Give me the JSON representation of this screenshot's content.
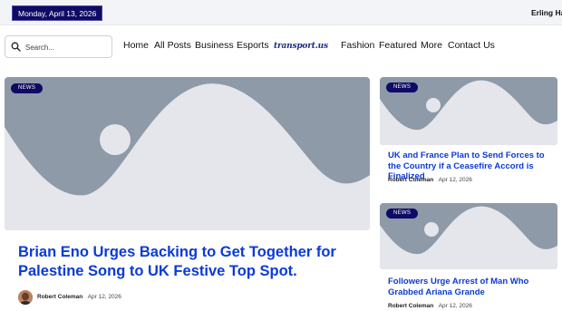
{
  "topbar": {
    "date": "Monday, April 13, 2026",
    "ticker": "Erling Haa"
  },
  "search": {
    "placeholder": "Search..."
  },
  "nav": {
    "items": [
      "Home",
      "All Posts",
      "Business",
      "Esports",
      "Fashion",
      "Featured",
      "More",
      "Contact Us"
    ],
    "logo_text": "transport.us"
  },
  "main_article": {
    "badge": "NEWS",
    "title": "Brian Eno Urges Backing to Get Together for Palestine Song to UK Festive Top Spot.",
    "author": "Robert Coleman",
    "date": "Apr 12, 2026"
  },
  "side_articles": [
    {
      "badge": "NEWS",
      "title": "UK and France Plan to Send Forces to the Country if a Ceasefire Accord is Finalized",
      "author": "Robert Coleman",
      "date": "Apr 12, 2026"
    },
    {
      "badge": "NEWS",
      "title": "Followers Urge Arrest of Man Who Grabbed Ariana Grande",
      "author": "Robert Coleman",
      "date": "Apr 12, 2026"
    }
  ],
  "colors": {
    "accent": "#0f0a63",
    "link": "#0b3ad6",
    "placeholder_shape": "#8e9aa8"
  }
}
